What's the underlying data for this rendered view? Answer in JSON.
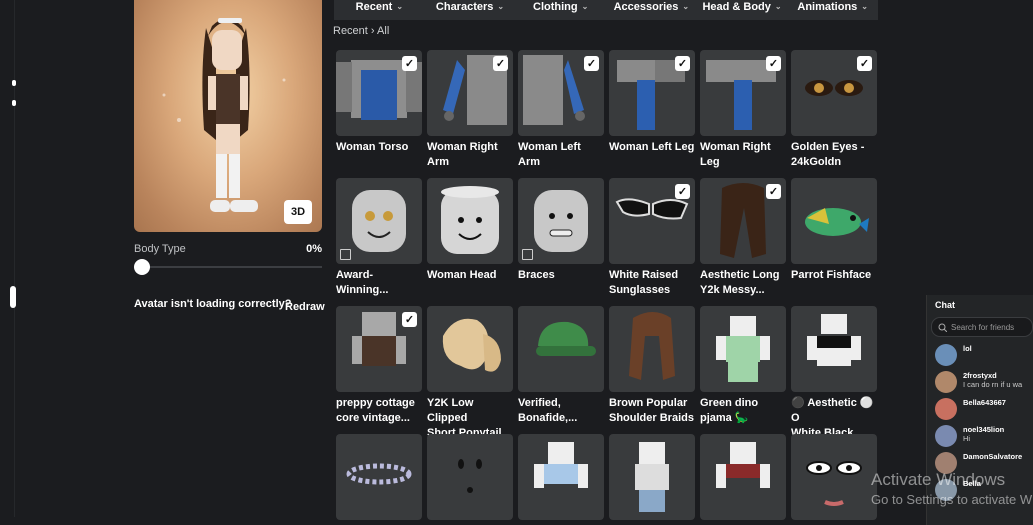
{
  "nav": {
    "tabs": [
      {
        "label": "Recent"
      },
      {
        "label": "Characters"
      },
      {
        "label": "Clothing"
      },
      {
        "label": "Accessories"
      },
      {
        "label": "Head & Body"
      },
      {
        "label": "Animations"
      }
    ]
  },
  "breadcrumb": {
    "parent": "Recent",
    "separator": "›",
    "current": "All"
  },
  "avatar": {
    "view_button": "3D"
  },
  "body_type": {
    "label": "Body Type",
    "value": "0%",
    "level": 0
  },
  "loading": {
    "message": "Avatar isn't loading correctly?",
    "redraw": "Redraw"
  },
  "items": [
    {
      "name": "Woman Torso",
      "checked": true
    },
    {
      "name": "Woman Right\nArm",
      "checked": true
    },
    {
      "name": "Woman Left Arm",
      "checked": true
    },
    {
      "name": "Woman Left Leg",
      "checked": true
    },
    {
      "name": "Woman Right\nLeg",
      "checked": true
    },
    {
      "name": "Golden Eyes -\n24kGoldn",
      "checked": true
    },
    {
      "name": "Award-\nWinning...",
      "checked": false
    },
    {
      "name": "Woman Head",
      "checked": false
    },
    {
      "name": "Braces",
      "checked": false
    },
    {
      "name": "White Raised\nSunglasses",
      "checked": true
    },
    {
      "name": "Aesthetic Long\nY2k Messy...",
      "checked": true
    },
    {
      "name": "Parrot Fishface",
      "checked": false
    },
    {
      "name": "preppy cottage\ncore vintage...",
      "checked": true
    },
    {
      "name": "Y2K Low Clipped\nShort Ponytail -...",
      "checked": false
    },
    {
      "name": "Verified,\nBonafide,...",
      "checked": false
    },
    {
      "name": "Brown Popular\nShoulder Braids",
      "checked": false
    },
    {
      "name": "Green dino\npjama 🦕",
      "checked": false
    },
    {
      "name": "⚫ Aesthetic ⚪ O\nWhite Black...",
      "checked": false
    },
    {
      "name": "",
      "checked": false
    },
    {
      "name": "",
      "checked": false
    },
    {
      "name": "",
      "checked": false
    },
    {
      "name": "",
      "checked": false
    },
    {
      "name": "",
      "checked": false
    },
    {
      "name": "",
      "checked": false
    }
  ],
  "chat": {
    "title": "Chat",
    "search_placeholder": "Search for friends",
    "friends": [
      {
        "name": "lol",
        "message": ""
      },
      {
        "name": "2frostyxd",
        "message": "I can do rn if u wa"
      },
      {
        "name": "Bella643667",
        "message": ""
      },
      {
        "name": "noel345lion",
        "message": "Hi"
      },
      {
        "name": "DamonSalvatore",
        "message": ""
      },
      {
        "name": "Bella",
        "message": ""
      }
    ]
  },
  "watermark": {
    "line1": "Activate Windows",
    "line2": "Go to Settings to activate W"
  },
  "colors": {
    "background": "#1b1c1f",
    "tile": "#393b3d",
    "nav": "#2c2e31"
  }
}
